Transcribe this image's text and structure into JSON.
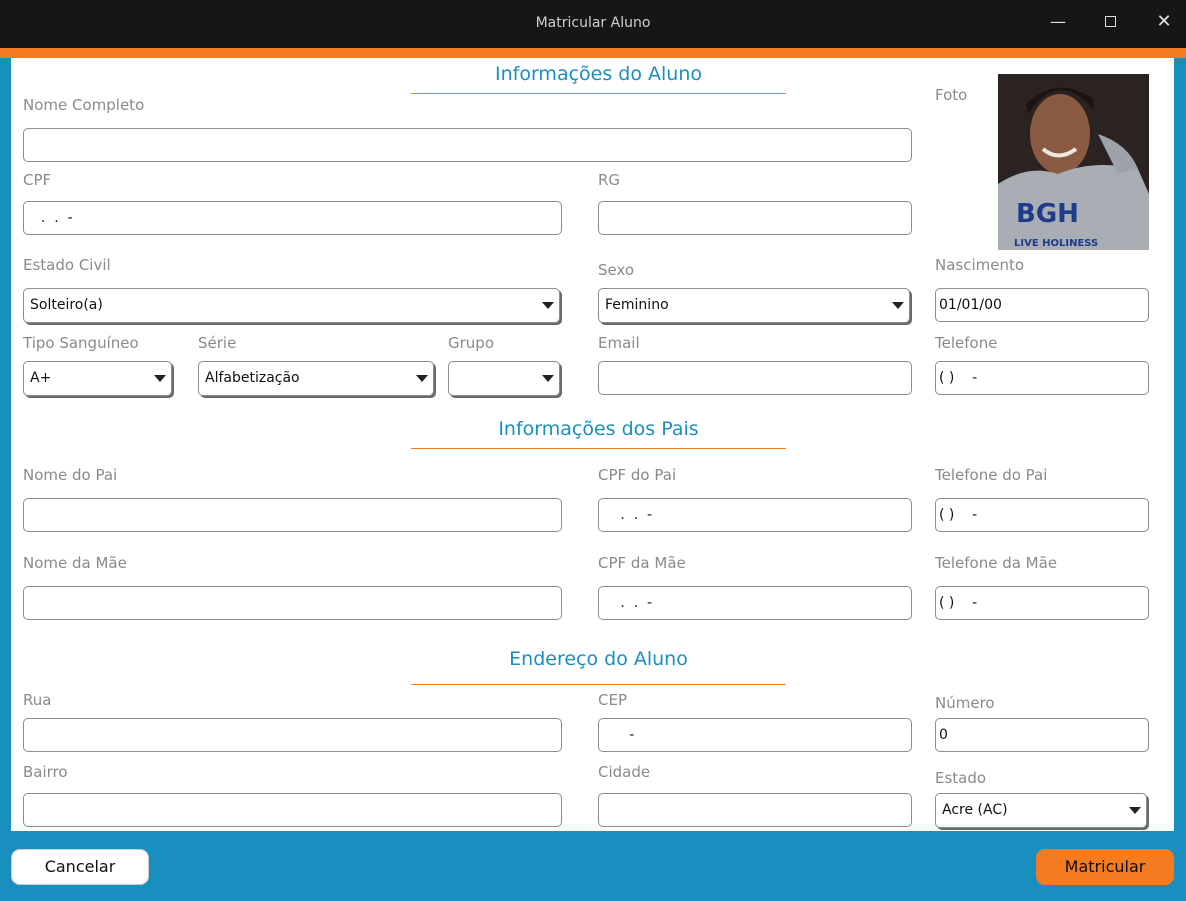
{
  "window": {
    "title": "Matricular Aluno",
    "minimize": "—",
    "close": "✕"
  },
  "sections": {
    "student": "Informações do Aluno",
    "parents": "Informações dos Pais",
    "address": "Endereço do Aluno"
  },
  "student": {
    "name_label": "Nome Completo",
    "name_value": "",
    "photo_label": "Foto",
    "photo_text": "BGH",
    "photo_subtext": "LIVE HOLINESS",
    "cpf_label": "CPF",
    "cpf_value": "  .  .  -",
    "rg_label": "RG",
    "rg_value": "",
    "marital_label": "Estado Civil",
    "marital_value": "Solteiro(a)",
    "sex_label": "Sexo",
    "sex_value": "Feminino",
    "birth_label": "Nascimento",
    "birth_value": "01/01/00",
    "blood_label": "Tipo Sanguíneo",
    "blood_value": "A+",
    "grade_label": "Série",
    "grade_value": "Alfabetização",
    "group_label": "Grupo",
    "group_value": "",
    "email_label": "Email",
    "email_value": "",
    "phone_label": "Telefone",
    "phone_value": "( )    -"
  },
  "parents": {
    "father_name_label": "Nome do Pai",
    "father_name_value": "",
    "father_cpf_label": "CPF do Pai",
    "father_cpf_value": "   .  .  -",
    "father_phone_label": "Telefone do Pai",
    "father_phone_value": "( )    -",
    "mother_name_label": "Nome da Mãe",
    "mother_name_value": "",
    "mother_cpf_label": "CPF da Mãe",
    "mother_cpf_value": "   .  .  -",
    "mother_phone_label": "Telefone da Mãe",
    "mother_phone_value": "( )    -"
  },
  "address": {
    "street_label": "Rua",
    "street_value": "",
    "cep_label": "CEP",
    "cep_value": "     -",
    "number_label": "Número",
    "number_value": "0",
    "district_label": "Bairro",
    "district_value": "",
    "city_label": "Cidade",
    "city_value": "",
    "state_label": "Estado",
    "state_value": "Acre (AC)"
  },
  "buttons": {
    "cancel": "Cancelar",
    "submit": "Matricular"
  },
  "colors": {
    "accent_orange": "#f47b20",
    "accent_blue": "#1a8fbf",
    "titlebar": "#161616"
  }
}
